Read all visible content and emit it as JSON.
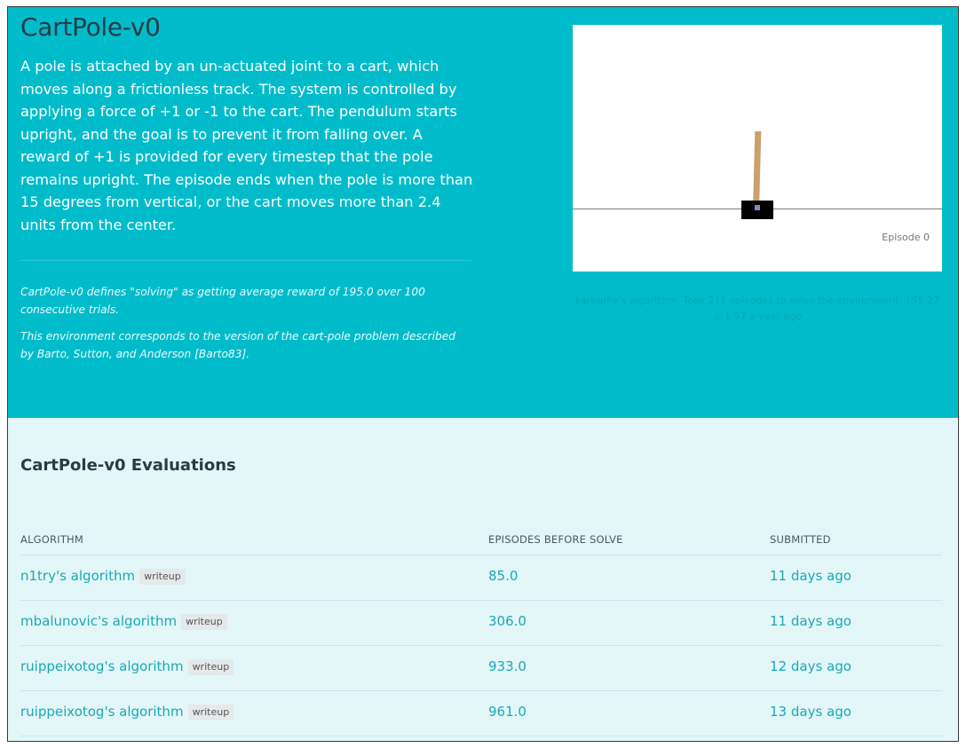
{
  "environment": {
    "title": "CartPole-v0",
    "description": "A pole is attached by an un-actuated joint to a cart, which moves along a frictionless track. The system is controlled by applying a force of +1 or -1 to the cart. The pendulum starts upright, and the goal is to prevent it from falling over. A reward of +1 is provided for every timestep that the pole remains upright. The episode ends when the pole is more than 15 degrees from vertical, or the cart moves more than 2.4 units from the center.",
    "notes": [
      "CartPole-v0 defines \"solving\" as getting average reward of 195.0 over 100 consecutive trials.",
      "This environment corresponds to the version of the cart-pole problem described by Barto, Sutton, and Anderson [Barto83]."
    ]
  },
  "visualization": {
    "episode_label": "Episode 0",
    "caption": "karpathy's algorithm. Took 211 episodes to solve the environment. 195.27 ± 1.57 a year ago"
  },
  "evaluations": {
    "title": "CartPole-v0 Evaluations",
    "columns": {
      "algorithm": "ALGORITHM",
      "episodes": "EPISODES BEFORE SOLVE",
      "submitted": "SUBMITTED"
    },
    "rows": [
      {
        "algorithm": "n1try's algorithm",
        "tag": "writeup",
        "episodes": "85.0",
        "submitted": "11 days ago"
      },
      {
        "algorithm": "mbalunovic's algorithm",
        "tag": "writeup",
        "episodes": "306.0",
        "submitted": "11 days ago"
      },
      {
        "algorithm": "ruippeixotog's algorithm",
        "tag": "writeup",
        "episodes": "933.0",
        "submitted": "12 days ago"
      },
      {
        "algorithm": "ruippeixotog's algorithm",
        "tag": "writeup",
        "episodes": "961.0",
        "submitted": "13 days ago"
      }
    ]
  },
  "colors": {
    "hero_background": "#00bccb",
    "page_background": "#e3f7f9",
    "link": "#1aa9b5",
    "pole": "#caa06b",
    "cart": "#000000"
  }
}
